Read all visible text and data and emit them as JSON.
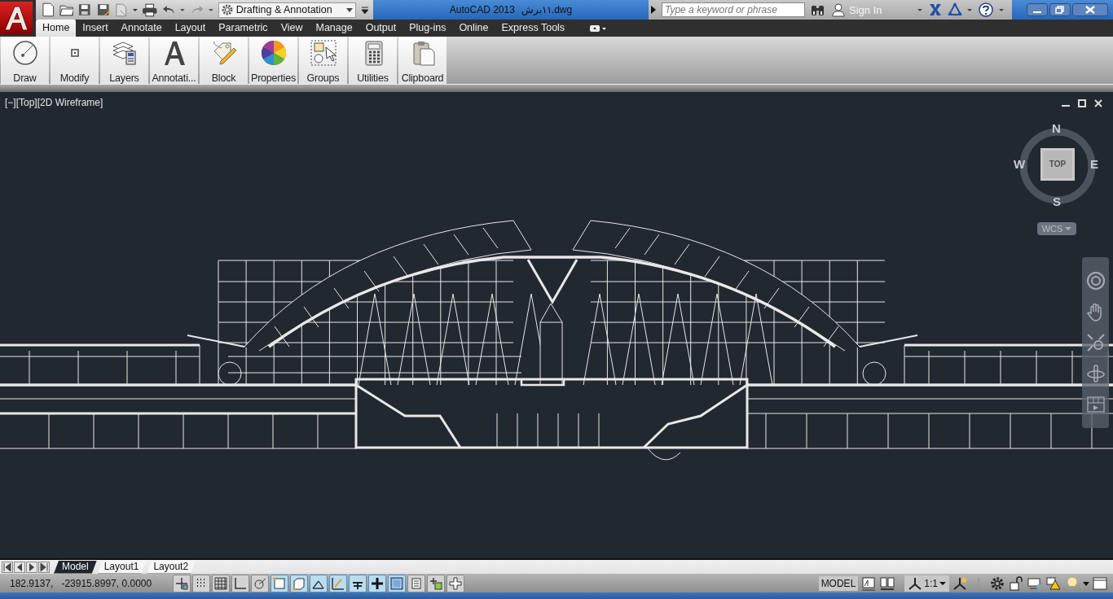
{
  "title_bar": {
    "workspace": "Drafting & Annotation",
    "app_name": "AutoCAD 2013",
    "file_name": "١١برش.dwg",
    "search": {
      "placeholder": "Type a keyword or phrase"
    },
    "sign_in": "Sign In"
  },
  "ribbon_tabs": [
    {
      "label": "Home",
      "selected": true
    },
    {
      "label": "Insert",
      "selected": false
    },
    {
      "label": "Annotate",
      "selected": false
    },
    {
      "label": "Layout",
      "selected": false
    },
    {
      "label": "Parametric",
      "selected": false
    },
    {
      "label": "View",
      "selected": false
    },
    {
      "label": "Manage",
      "selected": false
    },
    {
      "label": "Output",
      "selected": false
    },
    {
      "label": "Plug-ins",
      "selected": false
    },
    {
      "label": "Online",
      "selected": false
    },
    {
      "label": "Express Tools",
      "selected": false
    }
  ],
  "ribbon_panels": [
    {
      "label": "Draw",
      "kind": "draw"
    },
    {
      "label": "Modify",
      "kind": "modify"
    },
    {
      "label": "Layers",
      "kind": "layers"
    },
    {
      "label": "Annotati...",
      "kind": "annotation"
    },
    {
      "label": "Block",
      "kind": "block"
    },
    {
      "label": "Properties",
      "kind": "properties"
    },
    {
      "label": "Groups",
      "kind": "groups"
    },
    {
      "label": "Utilities",
      "kind": "utilities"
    },
    {
      "label": "Clipboard",
      "kind": "clipboard"
    }
  ],
  "viewport": {
    "label": "[−][Top][2D Wireframe]",
    "viewcube": {
      "north": "N",
      "south": "S",
      "east": "E",
      "west": "W",
      "face": "TOP"
    },
    "ucs": "WCS"
  },
  "layout_tabs": [
    {
      "label": "Model",
      "kind": "model",
      "selected": true
    },
    {
      "label": "Layout1",
      "kind": "layout",
      "selected": false
    },
    {
      "label": "Layout2",
      "kind": "layout",
      "selected": false
    }
  ],
  "status_bar": {
    "coordinates": "182.9137,   -23915.8997, 0.0000",
    "toggles": [
      {
        "kind": "infer",
        "on": false
      },
      {
        "kind": "snap",
        "on": false
      },
      {
        "kind": "grid",
        "on": false
      },
      {
        "kind": "ortho",
        "on": false
      },
      {
        "kind": "polar",
        "on": false
      },
      {
        "kind": "osnap",
        "on": true
      },
      {
        "kind": "osnap3d",
        "on": true
      },
      {
        "kind": "otrack",
        "on": true
      },
      {
        "kind": "ducs",
        "on": true
      },
      {
        "kind": "dyn",
        "on": true
      },
      {
        "kind": "lwt",
        "on": true
      },
      {
        "kind": "tpy",
        "on": true
      },
      {
        "kind": "qp",
        "on": false
      },
      {
        "kind": "sc",
        "on": false
      },
      {
        "kind": "am",
        "on": false
      }
    ],
    "space": "MODEL",
    "annotation_scale": "1:1"
  }
}
